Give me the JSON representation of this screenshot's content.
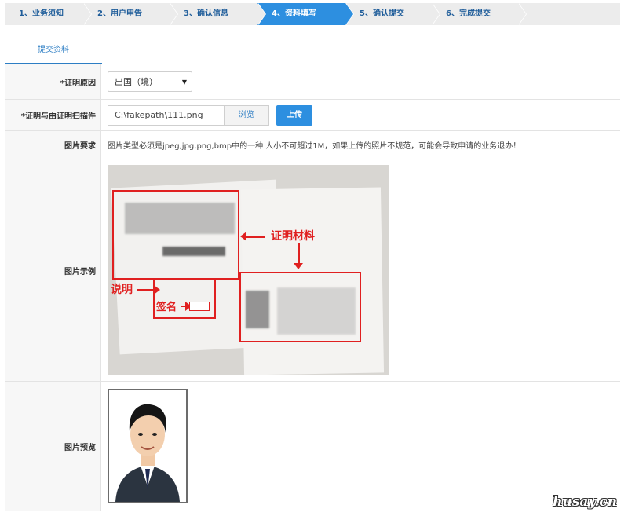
{
  "steps": [
    {
      "label": "1、业务须知"
    },
    {
      "label": "2、用户申告"
    },
    {
      "label": "3、确认信息"
    },
    {
      "label": "4、资料填写"
    },
    {
      "label": "5、确认提交"
    },
    {
      "label": "6、完成提交"
    }
  ],
  "tab": {
    "label": "提交资料"
  },
  "form": {
    "reason_label": "*证明原因",
    "reason_value": "出国（境）",
    "file_label": "*证明与由证明扫描件",
    "file_value": "C:\\fakepath\\111.png",
    "browse_label": "浏览",
    "upload_label": "上传",
    "req_label": "图片要求",
    "req_text": "图片类型必须是jpeg,jpg,png,bmp中的一种 人小不可超过1M，如果上传的照片不规范，可能会导致申请的业务退办！",
    "example_label": "图片示例",
    "preview_label": "图片预览"
  },
  "example": {
    "annot_material": "证明材料",
    "annot_explain": "说明",
    "annot_sign": "签名"
  },
  "watermark": "husay.cn",
  "colors": {
    "accent": "#2d8fe0",
    "annotation": "#e02020"
  }
}
